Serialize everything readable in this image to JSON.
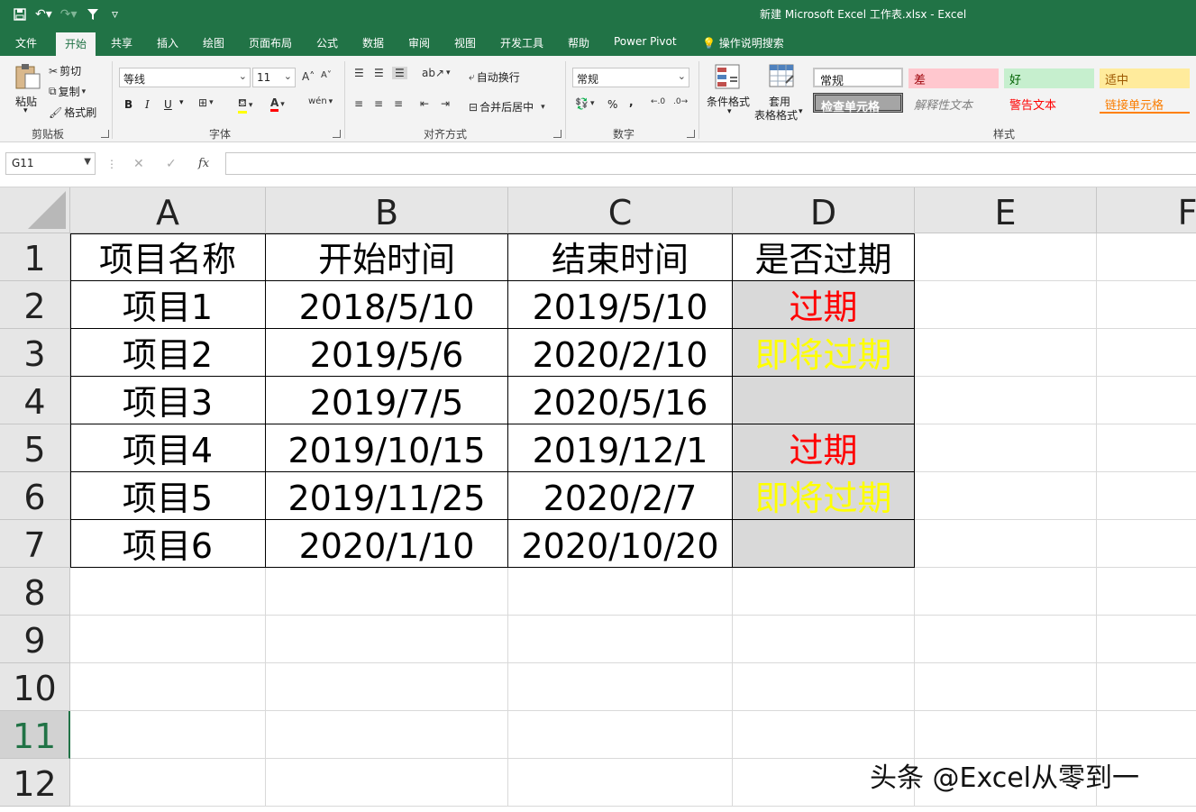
{
  "window": {
    "title": "新建 Microsoft Excel 工作表.xlsx  -  Excel"
  },
  "ribbon_tabs": [
    "文件",
    "开始",
    "共享",
    "插入",
    "绘图",
    "页面布局",
    "公式",
    "数据",
    "审阅",
    "视图",
    "开发工具",
    "帮助",
    "Power Pivot",
    "操作说明搜索"
  ],
  "ribbon": {
    "clipboard": {
      "paste": "粘贴",
      "cut": "剪切",
      "copy": "复制",
      "format_painter": "格式刷",
      "group": "剪贴板"
    },
    "font": {
      "name": "等线",
      "size": "11",
      "bold": "B",
      "italic": "I",
      "underline": "U",
      "group": "字体"
    },
    "alignment": {
      "wrap": "自动换行",
      "merge": "合并后居中",
      "group": "对齐方式"
    },
    "number": {
      "format": "常规",
      "percent": "%",
      "comma": ",",
      "group": "数字"
    },
    "styles": {
      "conditional": "条件格式",
      "table_format_1": "套用",
      "table_format_2": "表格格式",
      "group": "样式",
      "cells": [
        {
          "label": "常规",
          "bg": "#ffffff",
          "fg": "#000000"
        },
        {
          "label": "差",
          "bg": "#ffc7ce",
          "fg": "#9c0006"
        },
        {
          "label": "好",
          "bg": "#c6efce",
          "fg": "#006100"
        },
        {
          "label": "适中",
          "bg": "#ffeb9c",
          "fg": "#9c5700"
        },
        {
          "label": "检查单元格",
          "bg": "#a5a5a5",
          "fg": "#ffffff"
        },
        {
          "label": "解释性文本",
          "bg": "transparent",
          "fg": "#7f7f7f"
        },
        {
          "label": "警告文本",
          "bg": "transparent",
          "fg": "#ff0000"
        },
        {
          "label": "链接单元格",
          "bg": "transparent",
          "fg": "#fa7d00"
        }
      ]
    }
  },
  "formula_bar": {
    "name_box": "G11",
    "fx": "fx",
    "content": ""
  },
  "columns": [
    "A",
    "B",
    "C",
    "D",
    "E",
    "F"
  ],
  "rows": [
    "1",
    "2",
    "3",
    "4",
    "5",
    "6",
    "7",
    "8",
    "9",
    "10",
    "11",
    "12"
  ],
  "table": {
    "headers": [
      "项目名称",
      "开始时间",
      "结束时间",
      "是否过期"
    ],
    "data": [
      [
        "项目1",
        "2018/5/10",
        "2019/5/10",
        "过期"
      ],
      [
        "项目2",
        "2019/5/6",
        "2020/2/10",
        "即将过期"
      ],
      [
        "项目3",
        "2019/7/5",
        "2020/5/16",
        ""
      ],
      [
        "项目4",
        "2019/10/15",
        "2019/12/1",
        "过期"
      ],
      [
        "项目5",
        "2019/11/25",
        "2020/2/7",
        "即将过期"
      ],
      [
        "项目6",
        "2020/1/10",
        "2020/10/20",
        ""
      ]
    ],
    "status_colors": {
      "过期": "#ff0000",
      "即将过期": "#ffff00"
    }
  },
  "selected_cell": "G11",
  "watermark": "头条 @Excel从零到一",
  "colors": {
    "excel_green": "#217346"
  }
}
